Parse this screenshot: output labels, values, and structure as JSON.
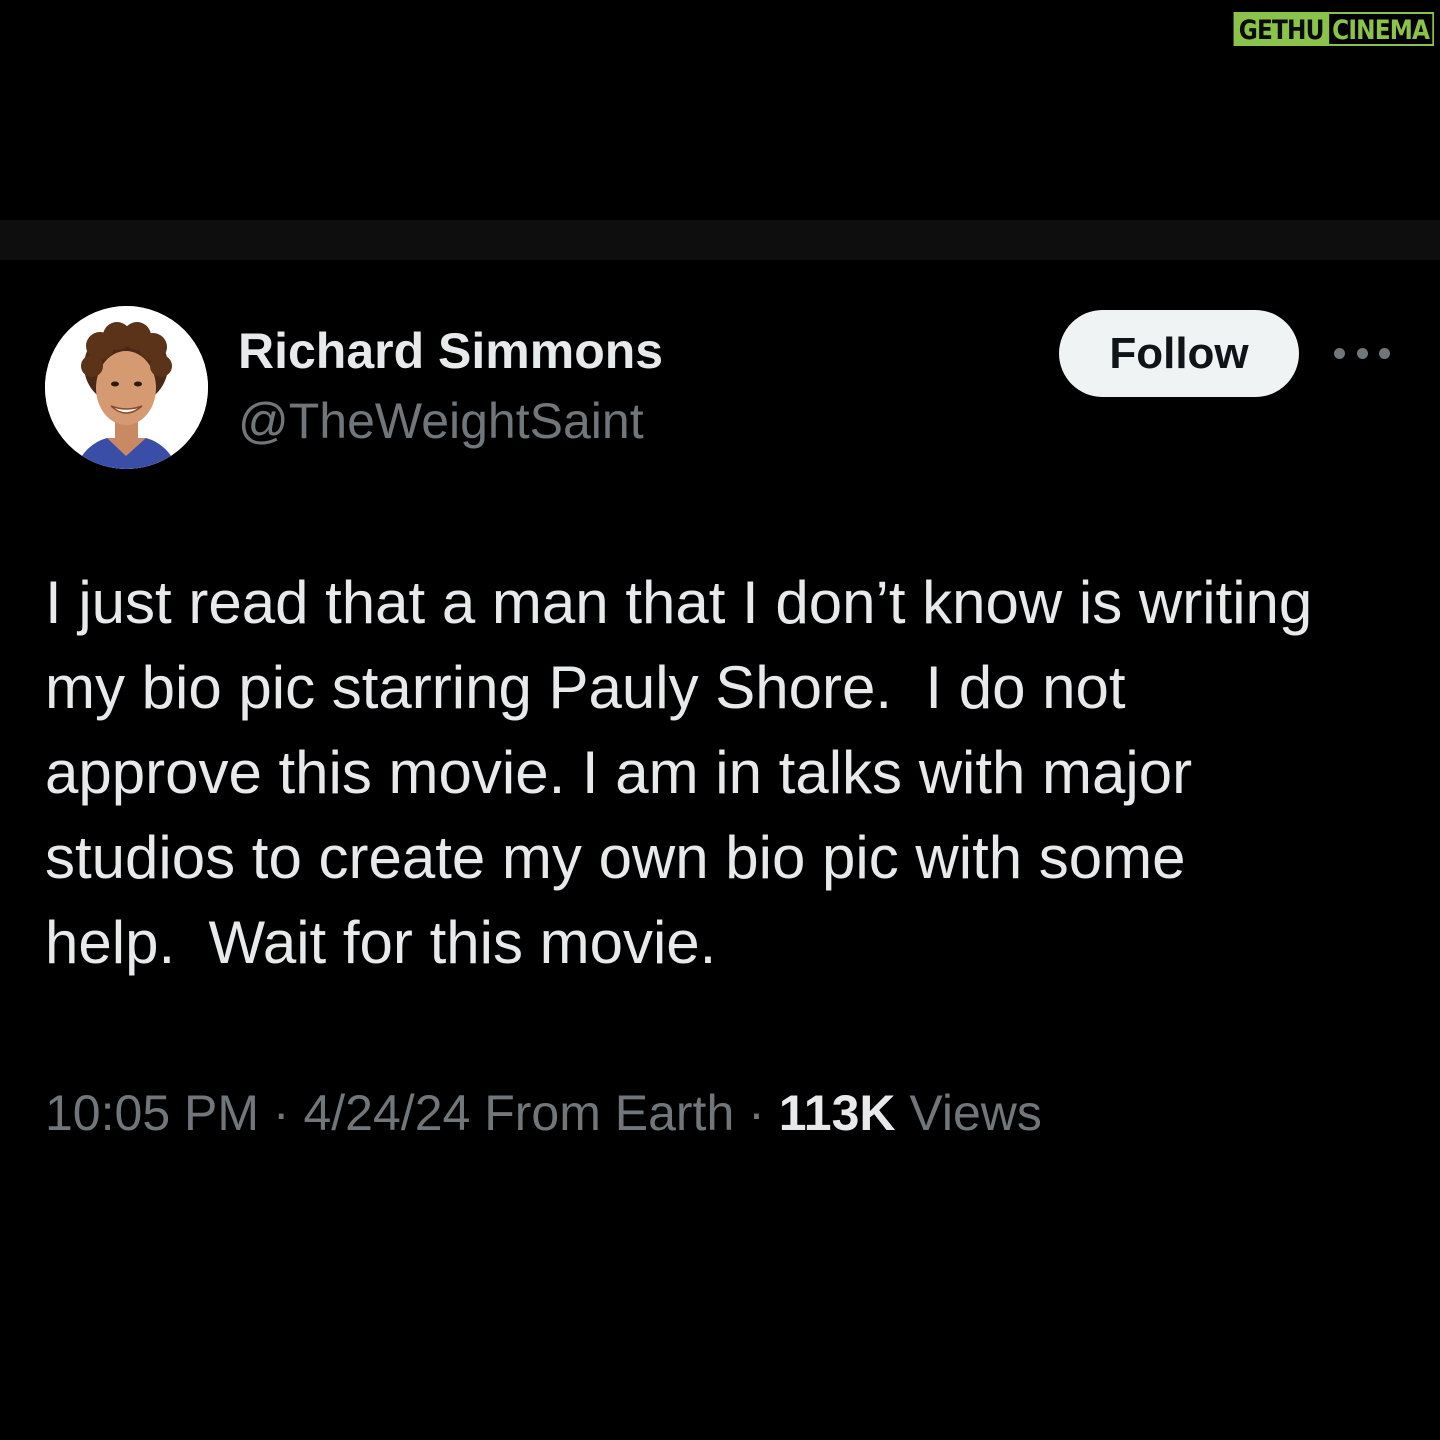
{
  "watermark": {
    "part1": "GETHU",
    "part2": "CINEMA",
    "color": "#8bc34a"
  },
  "tweet": {
    "author": {
      "display_name": "Richard Simmons",
      "handle": "@TheWeightSaint",
      "avatar_icon": "profile-photo"
    },
    "follow_label": "Follow",
    "more_icon": "ellipsis-icon",
    "text_lines": [
      "I just read that a man that I don’t know is writing",
      "my bio pic starring Pauly Shore.  I do not",
      "approve this movie. I am in talks with major",
      "studios to create my own bio pic with some",
      "help.  Wait for this movie."
    ],
    "meta": {
      "time": "10:05 PM",
      "separator": "·",
      "date_location": "4/24/24 From Earth",
      "views_count": "113K",
      "views_label": "Views"
    }
  },
  "colors": {
    "background": "#000000",
    "primary_text": "#e7e9ea",
    "secondary_text": "#71767b",
    "button_bg": "#eff3f4"
  }
}
